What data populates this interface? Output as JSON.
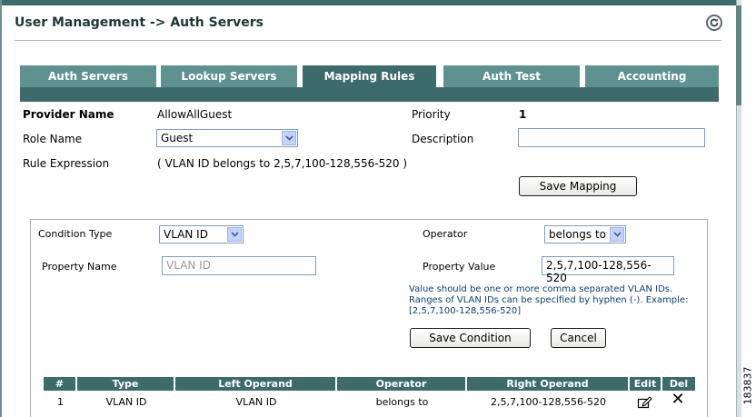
{
  "header": {
    "title": "User Management -> Auth Servers"
  },
  "tabs": [
    {
      "label": "Auth Servers",
      "active": false
    },
    {
      "label": "Lookup Servers",
      "active": false
    },
    {
      "label": "Mapping Rules",
      "active": true
    },
    {
      "label": "Auth Test",
      "active": false
    },
    {
      "label": "Accounting",
      "active": false
    }
  ],
  "mapping": {
    "provider_name_label": "Provider Name",
    "provider_name_value": "AllowAllGuest",
    "priority_label": "Priority",
    "priority_value": "1",
    "role_name_label": "Role Name",
    "role_name_value": "Guest",
    "description_label": "Description",
    "description_value": "",
    "rule_expression_label": "Rule Expression",
    "rule_expression_value": "( VLAN ID belongs to 2,5,7,100-128,556-520 )",
    "save_mapping_label": "Save Mapping"
  },
  "condition": {
    "condition_type_label": "Condition Type",
    "condition_type_value": "VLAN ID",
    "operator_label": "Operator",
    "operator_value": "belongs to",
    "property_name_label": "Property Name",
    "property_name_placeholder": "VLAN ID",
    "property_value_label": "Property Value",
    "property_value_value": "2,5,7,100-128,556-520",
    "hint": "Value should be one or more comma separated VLAN IDs. Ranges of VLAN IDs can be specified by hyphen (-). Example: [2,5,7,100-128,556-520]",
    "save_condition_label": "Save Condition",
    "cancel_label": "Cancel"
  },
  "table": {
    "columns": [
      "#",
      "Type",
      "Left Operand",
      "Operator",
      "Right Operand",
      "Edit",
      "Del"
    ],
    "rows": [
      {
        "num": "1",
        "type": "VLAN ID",
        "left": "VLAN ID",
        "operator": "belongs to",
        "right": "2,5,7,100-128,556-520"
      }
    ]
  },
  "side_code": "183837",
  "colors": {
    "tab_active": "#3d6b6b",
    "tab": "#5f9191",
    "hint_text": "#0b3f70"
  },
  "icons": [
    "refresh-icon",
    "dropdown-arrow-icon",
    "edit-icon",
    "delete-icon"
  ]
}
